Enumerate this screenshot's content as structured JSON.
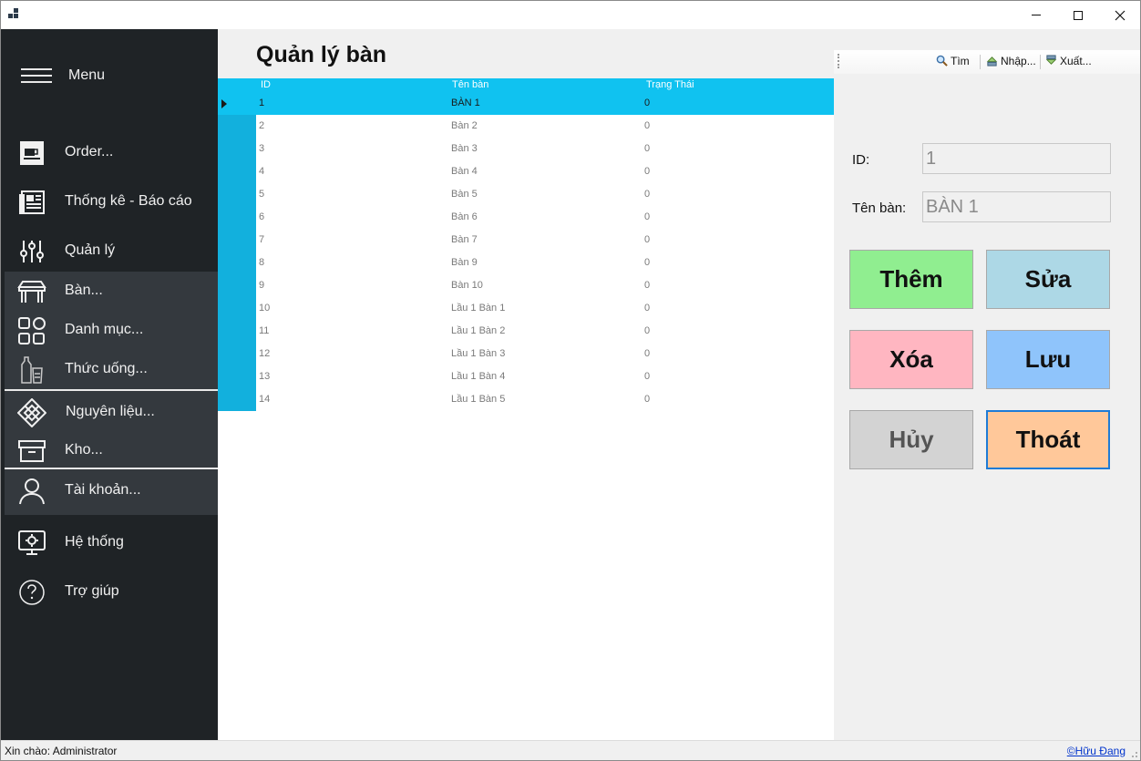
{
  "window": {
    "minimize_glyph": "",
    "close_glyph": "✕"
  },
  "sidebar": {
    "menu_label": "Menu",
    "items": [
      {
        "label": "Order...",
        "icon": "coffee-cup-icon"
      },
      {
        "label": "Thống kê - Báo cáo",
        "icon": "newspaper-icon"
      },
      {
        "label": "Quản lý",
        "icon": "sliders-icon"
      },
      {
        "label": "Bàn...",
        "icon": "table-icon"
      },
      {
        "label": "Danh mục...",
        "icon": "category-grid-icon"
      },
      {
        "label": "Thức uống...",
        "icon": "drinks-icon"
      },
      {
        "label": "Nguyên liệu...",
        "icon": "ingredients-icon"
      },
      {
        "label": "Kho...",
        "icon": "warehouse-box-icon"
      },
      {
        "label": "Tài khoản...",
        "icon": "user-icon"
      },
      {
        "label": "Hệ thống",
        "icon": "system-monitor-icon"
      },
      {
        "label": "Trợ giúp",
        "icon": "help-icon"
      }
    ]
  },
  "main": {
    "title": "Quản lý bàn",
    "grid": {
      "columns": [
        "ID",
        "Tên bàn",
        "Trạng Thái"
      ],
      "rows": [
        [
          "1",
          "BÀN 1",
          "0"
        ],
        [
          "2",
          "Bàn 2",
          "0"
        ],
        [
          "3",
          "Bàn 3",
          "0"
        ],
        [
          "4",
          "Bàn 4",
          "0"
        ],
        [
          "5",
          "Bàn 5",
          "0"
        ],
        [
          "6",
          "Bàn 6",
          "0"
        ],
        [
          "7",
          "Bàn 7",
          "0"
        ],
        [
          "8",
          "Bàn 9",
          "0"
        ],
        [
          "9",
          "Bàn 10",
          "0"
        ],
        [
          "10",
          "Lầu 1 Bàn 1",
          "0"
        ],
        [
          "11",
          "Lầu 1 Bàn 2",
          "0"
        ],
        [
          "12",
          "Lầu 1 Bàn 3",
          "0"
        ],
        [
          "13",
          "Lầu 1 Bàn 4",
          "0"
        ],
        [
          "14",
          "Lầu 1 Bàn 5",
          "0"
        ]
      ],
      "selected_row": 0
    }
  },
  "toolbar": {
    "search_label": "Tìm",
    "import_label": "Nhập...",
    "export_label": "Xuất..."
  },
  "form": {
    "id_label": "ID:",
    "id_value": "1",
    "name_label": "Tên bàn:",
    "name_value": "BÀN 1"
  },
  "buttons": {
    "add": {
      "label": "Thêm",
      "color": "#90ee90"
    },
    "edit": {
      "label": "Sửa",
      "color": "#add8e6"
    },
    "delete": {
      "label": "Xóa",
      "color": "#ffb6c1"
    },
    "save": {
      "label": "Lưu",
      "color": "#8fc4fb"
    },
    "cancel": {
      "label": "Hủy",
      "color": "#d3d3d3"
    },
    "exit": {
      "label": "Thoát",
      "color": "#ffc89a"
    }
  },
  "status": {
    "greeting": "Xin chào: Administrator",
    "author_link": "©Hữu Đang"
  },
  "colors": {
    "sidebar_bg": "#1f2326",
    "submenu_bg": "#34393e",
    "grid_header": "#10c2f0",
    "grid_rowheader": "#12b0dd"
  }
}
